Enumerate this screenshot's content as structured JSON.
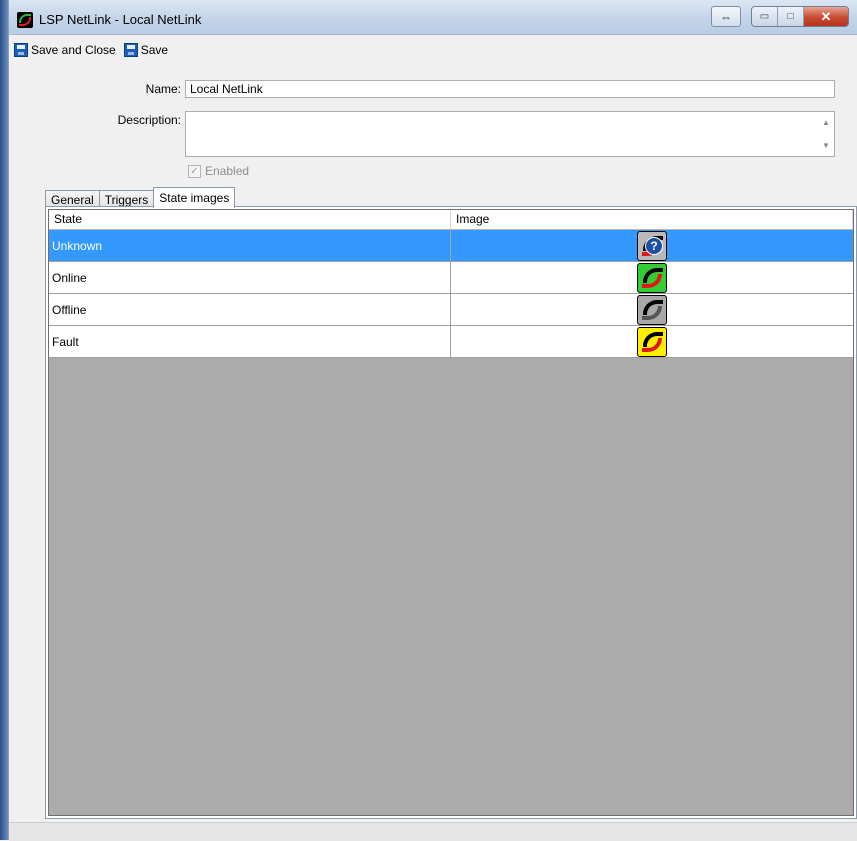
{
  "window": {
    "title": "LSP NetLink  -  Local NetLink",
    "restore_glyph": "⇔",
    "minimize_glyph": "▭",
    "maximize_glyph": "□",
    "close_glyph": "✕"
  },
  "toolbar": {
    "save_close_label": "Save and Close",
    "save_label": "Save"
  },
  "form": {
    "name_label": "Name:",
    "name_value": "Local NetLink",
    "description_label": "Description:",
    "description_value": "",
    "enabled_label": "Enabled",
    "enabled_checked": true
  },
  "tabs": [
    {
      "label": "General",
      "active": false
    },
    {
      "label": "Triggers",
      "active": false
    },
    {
      "label": "State images",
      "active": true
    }
  ],
  "grid": {
    "columns": [
      "State",
      "Image"
    ],
    "rows": [
      {
        "state": "Unknown",
        "image": "unknown-state-icon",
        "color": "#b9b9b9",
        "selected": true
      },
      {
        "state": "Online",
        "image": "online-state-icon",
        "color": "#33cc33",
        "selected": false
      },
      {
        "state": "Offline",
        "image": "offline-state-icon",
        "color": "#a8a8a8",
        "selected": false
      },
      {
        "state": "Fault",
        "image": "fault-state-icon",
        "color": "#ffee00",
        "selected": false
      }
    ]
  },
  "colors": {
    "selection": "#3399ff",
    "grid_background": "#ababab",
    "close_button": "#c84a32"
  }
}
